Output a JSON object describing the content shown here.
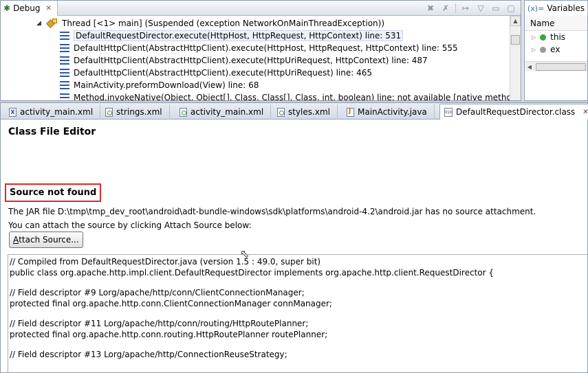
{
  "debug_view": {
    "tab_label": "Debug",
    "thread_label": "Thread [<1> main] (Suspended (exception NetworkOnMainThreadException))",
    "frames": [
      "DefaultRequestDirector.execute(HttpHost, HttpRequest, HttpContext) line: 531",
      "DefaultHttpClient(AbstractHttpClient).execute(HttpHost, HttpRequest, HttpContext) line: 555",
      "DefaultHttpClient(AbstractHttpClient).execute(HttpUriRequest, HttpContext) line: 487",
      "DefaultHttpClient(AbstractHttpClient).execute(HttpUriRequest) line: 465",
      "MainActivity.preformDownload(View) line: 68",
      "Method.invokeNative(Object, Object[], Class, Class[], Class, int, boolean) line: not available [native method]"
    ]
  },
  "variables_view": {
    "tab_label": "Variables",
    "column_header": "Name",
    "rows": [
      {
        "name": "this",
        "color": "#3aa535"
      },
      {
        "name": "ex",
        "color": "#9a9a9a"
      }
    ]
  },
  "editor_tabs": [
    {
      "label": "activity_main.xml",
      "icon": "xml-file-icon"
    },
    {
      "label": "strings.xml",
      "icon": "resource-file-icon"
    },
    {
      "label": "activity_main.xml",
      "icon": "resource-file-icon"
    },
    {
      "label": "styles.xml",
      "icon": "resource-file-icon"
    },
    {
      "label": "MainActivity.java",
      "icon": "java-file-icon"
    },
    {
      "label": "DefaultRequestDirector.class",
      "icon": "class-file-icon",
      "active": true
    }
  ],
  "class_editor": {
    "title": "Class File Editor",
    "source_not_found": "Source not found",
    "jar_message": "The JAR file D:\\tmp\\tmp_dev_root\\android\\adt-bundle-windows\\sdk\\platforms\\android-4.2\\android.jar has no source attachment.",
    "attach_hint": "You can attach the source by clicking Attach Source below:",
    "attach_button_mnemonic": "A",
    "attach_button_rest": "ttach Source...",
    "highlight_color": "#e0262a",
    "code_lines": [
      "// Compiled from DefaultRequestDirector.java (version 1.5 : 49.0, super bit)",
      "public class org.apache.http.impl.client.DefaultRequestDirector implements org.apache.http.client.RequestDirector {",
      "",
      "  // Field descriptor #9 Lorg/apache/http/conn/ClientConnectionManager;",
      "  protected final org.apache.http.conn.ClientConnectionManager connManager;",
      "",
      "  // Field descriptor #11 Lorg/apache/http/conn/routing/HttpRoutePlanner;",
      "  protected final org.apache.http.conn.routing.HttpRoutePlanner routePlanner;",
      "",
      "  // Field descriptor #13 Lorg/apache/http/ConnectionReuseStrategy;"
    ]
  }
}
